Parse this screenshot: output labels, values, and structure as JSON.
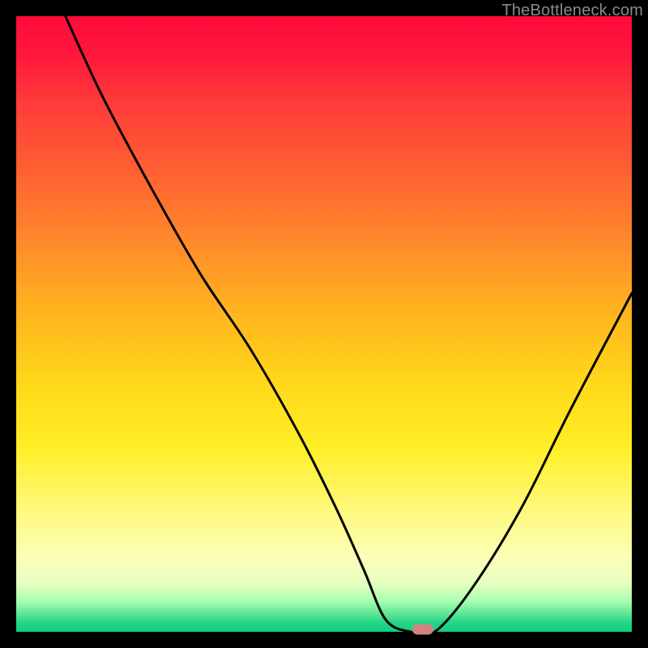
{
  "watermark": "TheBottleneck.com",
  "chart_data": {
    "type": "line",
    "title": "",
    "xlabel": "",
    "ylabel": "",
    "xlim": [
      0,
      100
    ],
    "ylim": [
      0,
      100
    ],
    "grid": false,
    "legend": false,
    "background": "red-yellow-green-gradient",
    "series": [
      {
        "name": "bottleneck-curve",
        "color": "#000000",
        "x": [
          8,
          14,
          22,
          30,
          38,
          46,
          52,
          56.5,
          60,
          64,
          68,
          74,
          82,
          90,
          100
        ],
        "y": [
          100,
          87,
          72,
          58,
          46,
          32,
          20,
          10,
          2,
          0,
          0,
          7,
          20,
          36,
          55
        ]
      }
    ],
    "marker": {
      "name": "optimal-point",
      "x": 66,
      "y": 0,
      "color": "#d4827d"
    }
  }
}
